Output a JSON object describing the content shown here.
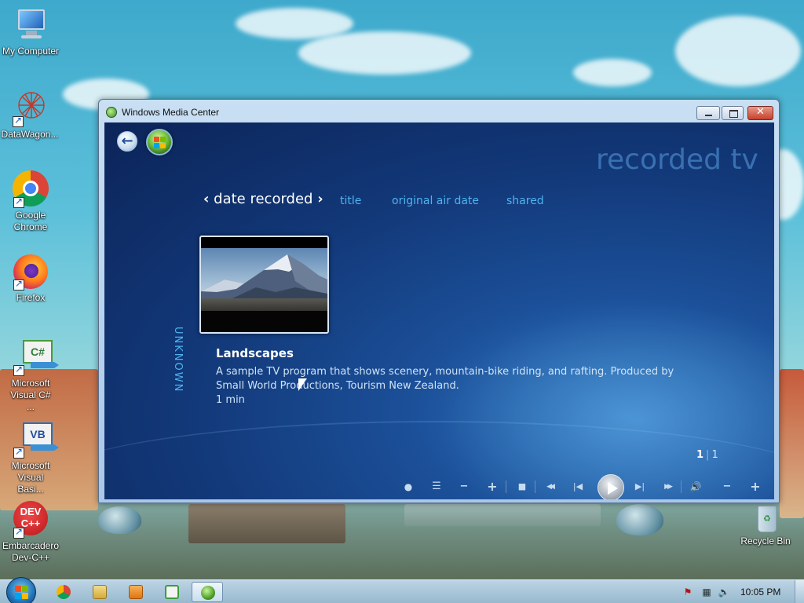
{
  "desktop": {
    "icons": [
      {
        "label": "My Computer",
        "icon": "computer-icon"
      },
      {
        "label": "DataWagon...",
        "icon": "datawagon-icon"
      },
      {
        "label": "Google Chrome",
        "icon": "chrome-icon"
      },
      {
        "label": "Firefox",
        "icon": "firefox-icon"
      },
      {
        "label": "Microsoft Visual C# ...",
        "icon": "visual-csharp-icon"
      },
      {
        "label": "Microsoft Visual Basi...",
        "icon": "visual-basic-icon"
      },
      {
        "label": "Embarcadero Dev-C++",
        "icon": "devcpp-icon"
      },
      {
        "label": "Recycle Bin",
        "icon": "recycle-bin-icon"
      }
    ],
    "csharp_badge": "C#",
    "vb_badge": "VB",
    "devcpp_badge_line1": "DEV",
    "devcpp_badge_line2": "C++"
  },
  "window": {
    "title": "Windows Media Center",
    "close_glyph": "✕"
  },
  "media_center": {
    "back_glyph": "←",
    "page_title": "recorded tv",
    "tabs": [
      {
        "label": "date recorded",
        "active": true
      },
      {
        "label": "title",
        "active": false
      },
      {
        "label": "original air date",
        "active": false
      },
      {
        "label": "shared",
        "active": false
      }
    ],
    "tab_prev_glyph": "‹",
    "tab_next_glyph": "›",
    "group_label": "UNKNOWN",
    "program": {
      "title": "Landscapes",
      "description": "A sample TV program that shows scenery, mountain-bike riding, and rafting. Produced by Small World Productions, Tourism New Zealand.",
      "duration": "1 min"
    },
    "pager": {
      "current": "1",
      "total": "1"
    },
    "transport": {
      "record": "●",
      "guide": "☰",
      "channel_down": "−",
      "channel_up": "+",
      "stop": "■",
      "rewind": "◀◀",
      "skip_back": "|◀",
      "skip_forward": "▶|",
      "fast_forward": "▶▶",
      "mute": "🔊",
      "volume_down": "−",
      "volume_up": "+"
    }
  },
  "taskbar": {
    "items": [
      {
        "name": "chrome",
        "icon": "chrome-icon",
        "color": "#e0452f"
      },
      {
        "name": "explorer",
        "icon": "folder-icon",
        "color": "#e8c65a"
      },
      {
        "name": "media-player",
        "icon": "media-player-icon",
        "color": "#f08a24"
      },
      {
        "name": "visual-csharp",
        "icon": "visual-csharp-icon",
        "color": "#3f9c3a"
      },
      {
        "name": "media-center",
        "icon": "media-center-icon",
        "color": "#62b33b",
        "active": true
      }
    ],
    "clock": "10:05 PM",
    "tray_icons": [
      "action-center-icon",
      "network-icon",
      "volume-icon"
    ]
  },
  "colors": {
    "accent_tab": "#4fb3f0",
    "media_center_bg": "#123878"
  }
}
